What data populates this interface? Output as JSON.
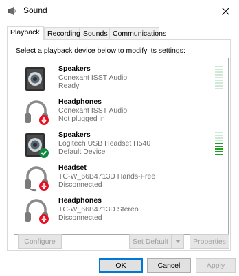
{
  "window": {
    "title": "Sound",
    "close_icon": "close-icon"
  },
  "tabs": [
    {
      "label": "Playback",
      "active": true
    },
    {
      "label": "Recording",
      "active": false
    },
    {
      "label": "Sounds",
      "active": false
    },
    {
      "label": "Communications",
      "active": false
    }
  ],
  "instruction": "Select a playback device below to modify its settings:",
  "devices": [
    {
      "name": "Speakers",
      "line1": "Conexant ISST Audio",
      "line2": "Ready",
      "icon": "speaker-icon",
      "status": "none",
      "meter_level": 0.0
    },
    {
      "name": "Headphones",
      "line1": "Conexant ISST Audio",
      "line2": "Not plugged in",
      "icon": "headphones-icon",
      "status": "unplugged",
      "meter_level": null
    },
    {
      "name": "Speakers",
      "line1": "Logitech USB Headset H540",
      "line2": "Default Device",
      "icon": "speaker-icon",
      "status": "default",
      "meter_level": 0.55
    },
    {
      "name": "Headset",
      "line1": "TC-W_66B4713D Hands-Free",
      "line2": "Disconnected",
      "icon": "headset-icon",
      "status": "disconnected",
      "meter_level": null
    },
    {
      "name": "Headphones",
      "line1": "TC-W_66B4713D Stereo",
      "line2": "Disconnected",
      "icon": "headphones-icon",
      "status": "disconnected",
      "meter_level": null
    }
  ],
  "buttons": {
    "configure": "Configure",
    "set_default": "Set Default",
    "properties": "Properties",
    "ok": "OK",
    "cancel": "Cancel",
    "apply": "Apply"
  },
  "colors": {
    "accent": "#0078d7",
    "default_check": "#10893e",
    "error_badge": "#e81123",
    "meter_active": "#20a020"
  }
}
